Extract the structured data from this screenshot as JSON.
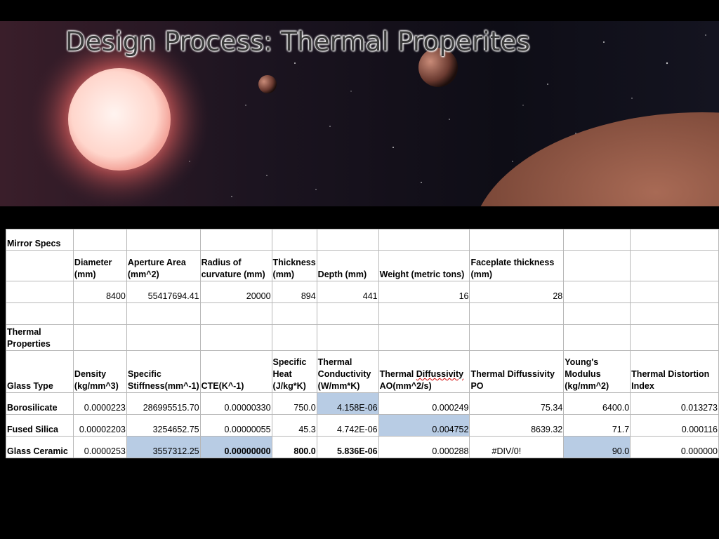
{
  "slide": {
    "title": "Design Process: Thermal Properites"
  },
  "mirror_specs": {
    "section_label": "Mirror Specs",
    "headers": [
      "Diameter (mm)",
      "Aperture Area (mm^2)",
      "Radius of curvature (mm)",
      "Thickness (mm)",
      "Depth (mm)",
      "Weight (metric tons)",
      "Faceplate thickness (mm)"
    ],
    "values": [
      "8400",
      "55417694.41",
      "20000",
      "894",
      "441",
      "16",
      "28"
    ]
  },
  "thermal": {
    "section_label": "Thermal Properties",
    "row_header": "Glass Type",
    "headers": [
      "Density (kg/mm^3)",
      "Specific Stiffness(mm^-1)",
      "CTE(K^-1)",
      "Specific Heat (J/kg*K)",
      "Thermal Conductivity (W/mm*K)",
      "Thermal Diffussivity AO(mm^2/s)",
      "Thermal Diffussivity PO",
      "Young's Modulus (kg/mm^2)",
      "Thermal Distortion Index"
    ],
    "rows": [
      {
        "name": "Borosilicate",
        "values": [
          "0.0000223",
          "286995515.70",
          "0.00000330",
          "750.0",
          "4.158E-06",
          "0.000249",
          "75.34",
          "6400.0",
          "0.013273"
        ]
      },
      {
        "name": "Fused Silica",
        "values": [
          "0.00002203",
          "3254652.75",
          "0.00000055",
          "45.3",
          "4.742E-06",
          "0.004752",
          "8639.32",
          "71.7",
          "0.000116"
        ]
      },
      {
        "name": "Glass Ceramic",
        "values": [
          "0.0000253",
          "3557312.25",
          "0.00000000",
          "800.0",
          "5.836E-06",
          "0.000288",
          "#DIV/0!",
          "90.0",
          "0.000000"
        ]
      }
    ]
  },
  "highlight_color": "#b8cce4"
}
